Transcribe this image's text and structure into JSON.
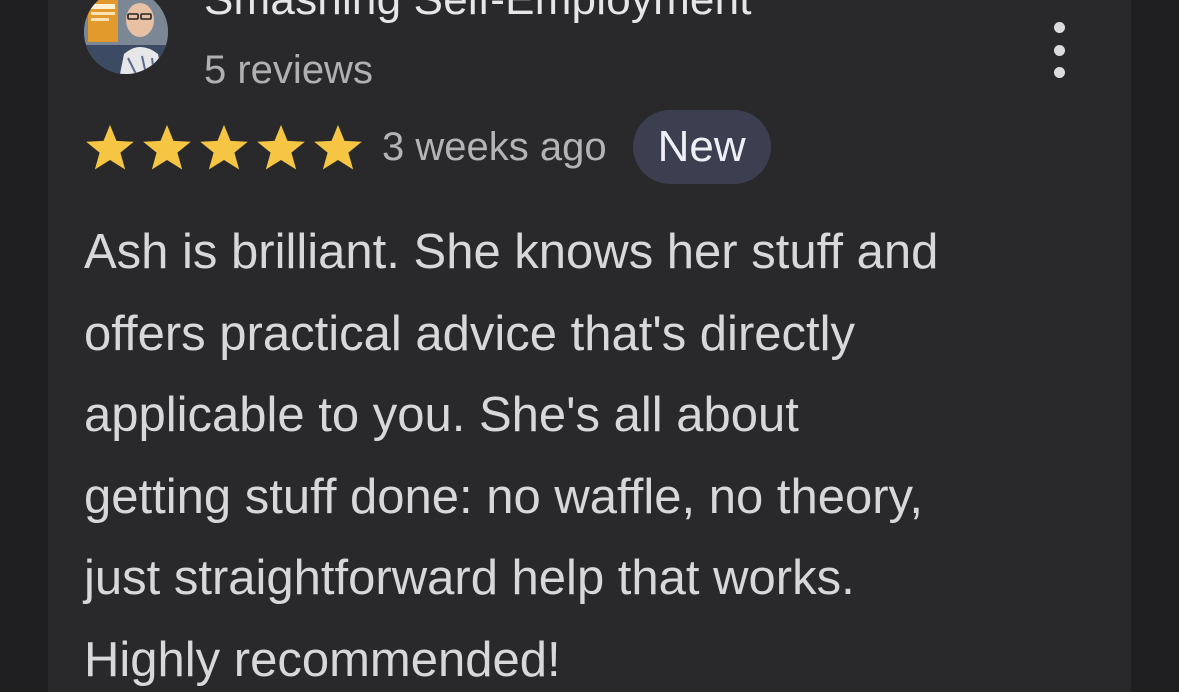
{
  "reviewer": {
    "name": "Smashing Self-Employment",
    "reviews_count": "5 reviews"
  },
  "rating": {
    "stars": 5,
    "max_stars": 5,
    "date": "3 weeks ago",
    "badge": "New"
  },
  "review": {
    "lines": [
      "Ash is brilliant. She knows her stuff and",
      "offers practical advice that's directly",
      "applicable to you. She's all about",
      "getting stuff done: no waffle, no theory,",
      "just straightforward help that works.",
      "Highly recommended!"
    ]
  },
  "colors": {
    "background": "#1f1f21",
    "card": "#29292b",
    "star": "#f6c543",
    "badge_bg": "#3b3f4f"
  },
  "icons": {
    "more": "more-vert-icon",
    "star": "star-icon"
  }
}
